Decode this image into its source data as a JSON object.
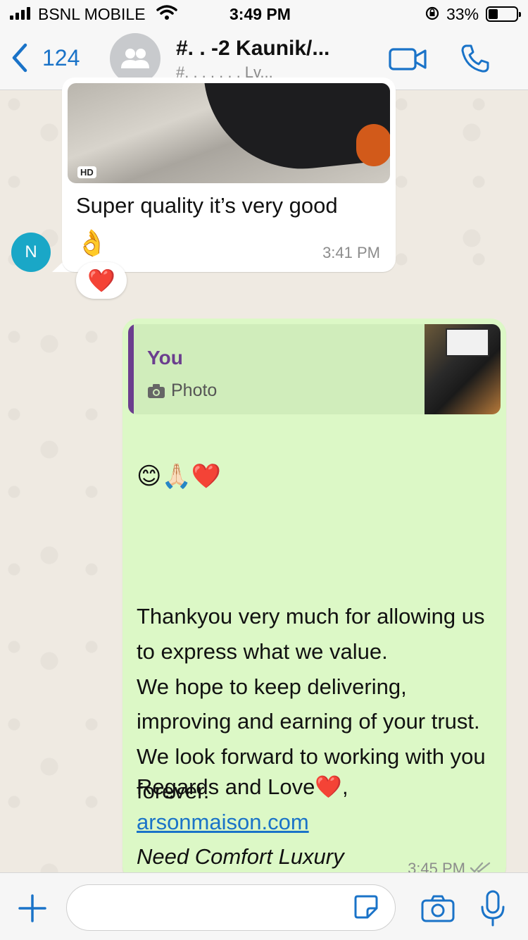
{
  "status_bar": {
    "carrier": "BSNL MOBILE",
    "time": "3:49 PM",
    "battery_percent": "33%",
    "battery_level": 0.33
  },
  "header": {
    "back_count": "124",
    "title": "#. . -2 Kaunik/...",
    "subtitle": "#. . . . . . , Lv...",
    "icons": {
      "back": "chevron-left-icon",
      "avatar": "group-avatar-icon",
      "video": "video-call-icon",
      "call": "phone-icon"
    }
  },
  "messages": [
    {
      "direction": "incoming",
      "sender_initial": "N",
      "hd_badge": "HD",
      "text": "Super quality it’s very good",
      "emoji": "👌",
      "time": "3:41 PM",
      "reaction": "❤️"
    },
    {
      "direction": "outgoing",
      "quote_author": "You",
      "quote_type": "Photo",
      "emojis": "😊🙏🏻❤️",
      "body": "Thankyou very much for allowing us to express what we value.\nWe hope to keep delivering, improving and earning of your trust.\nWe look forward to working with you forever.",
      "signoff": "Regards and Love❤️,",
      "link": "arsonmaison.com",
      "tagline": "Need Comfort Luxury",
      "time": "3:45 PM",
      "read_status": "double-tick-icon"
    }
  ],
  "input": {
    "placeholder": "",
    "icons": {
      "plus": "plus-icon",
      "sticker": "sticker-icon",
      "camera": "camera-icon",
      "mic": "microphone-icon"
    }
  },
  "colors": {
    "accent": "#1a73c8",
    "outgoing_bubble": "#dcf8c6",
    "incoming_bubble": "#ffffff",
    "quote_author": "#6b3e8e",
    "heart": "#e0102b"
  }
}
